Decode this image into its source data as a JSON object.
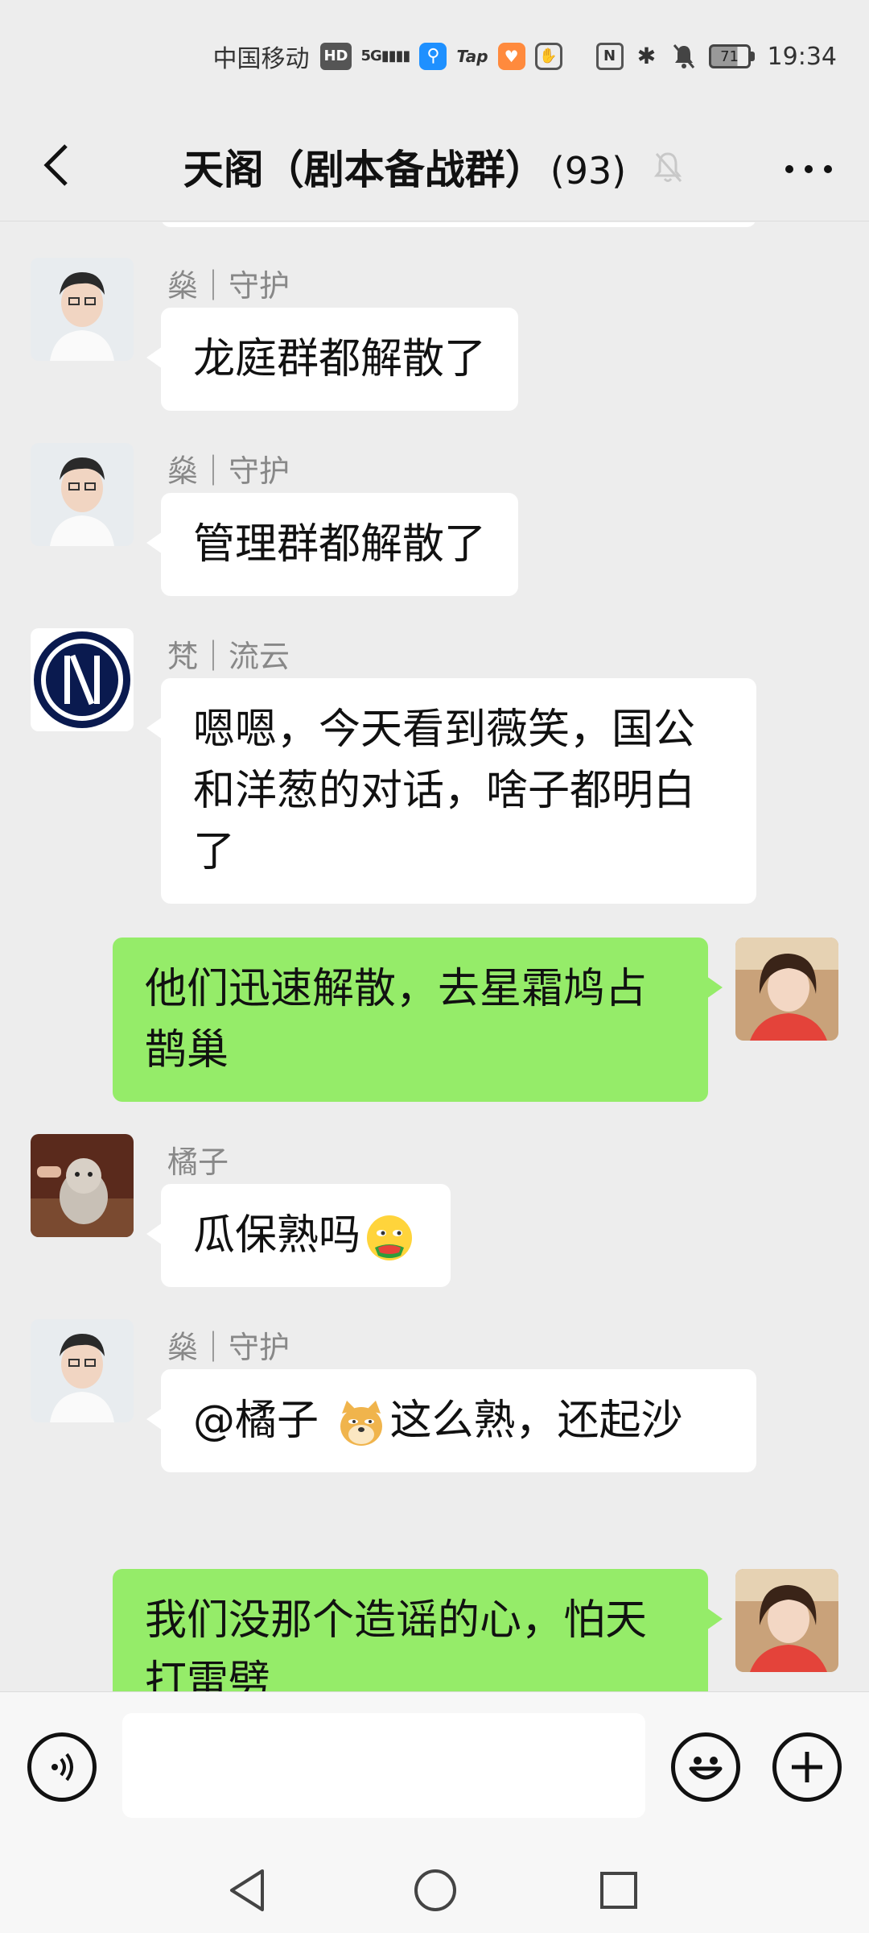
{
  "status_bar": {
    "carrier": "中国移动",
    "hd": "HD",
    "signal": "5G",
    "tap": "Tap",
    "nfc": "N",
    "battery": "71",
    "time": "19:34"
  },
  "header": {
    "title": "天阁（剧本备战群）",
    "member_count": "(93)"
  },
  "messages": [
    {
      "sender": "燊｜守护",
      "text": "龙庭群都解散了"
    },
    {
      "sender": "燊｜守护",
      "text": "管理群都解散了"
    },
    {
      "sender": "梵｜流云",
      "text": "嗯嗯，今天看到薇笑，国公和洋葱的对话，啥子都明白了"
    },
    {
      "sender": "",
      "text": "他们迅速解散，去星霜鸠占鹊巢"
    },
    {
      "sender": "橘子",
      "text": "瓜保熟吗"
    },
    {
      "sender": "燊｜守护",
      "text_a": "@橘子 ",
      "text_b": "这么熟，还起沙"
    },
    {
      "sender": "",
      "text": "我们没那个造谣的心，怕天打雷劈"
    }
  ],
  "input": {
    "placeholder": ""
  },
  "colors": {
    "my_bubble": "#95ec69",
    "other_bubble": "#ffffff",
    "background": "#ededed"
  }
}
